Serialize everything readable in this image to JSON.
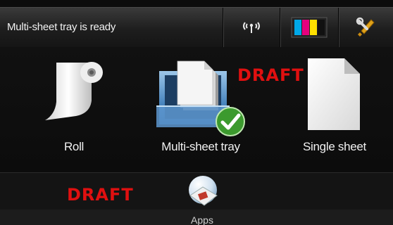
{
  "status": {
    "message": "Multi-sheet tray is ready"
  },
  "toolbar": {
    "wireless_icon": "wireless-icon",
    "ink_icon": "ink-cartridges-icon",
    "settings_icon": "wrench-screwdriver-icon",
    "ink_colors": [
      "#00a8e8",
      "#e5007e",
      "#ffe000",
      "#111111"
    ]
  },
  "media": [
    {
      "label": "Roll",
      "icon": "paper-roll-icon"
    },
    {
      "label": "Multi-sheet tray",
      "icon": "tray-icon",
      "selected": true
    },
    {
      "label": "Single sheet",
      "icon": "single-sheet-icon"
    }
  ],
  "watermarks": {
    "top": "DRAFT",
    "bottom": "DRAFT"
  },
  "apps": {
    "label": "Apps",
    "icon": "apps-icon"
  },
  "colors": {
    "draft_red": "#e01010",
    "check_green": "#3c9a2e"
  }
}
